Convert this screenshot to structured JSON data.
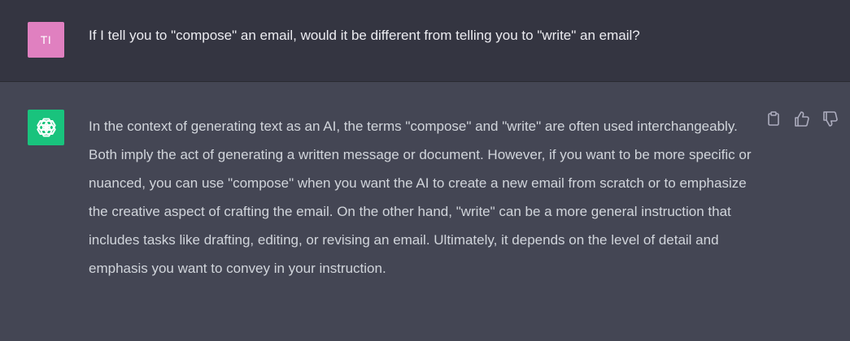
{
  "user": {
    "avatar_initials": "TI",
    "avatar_color": "#e080c0",
    "message": "If I tell you to \"compose\" an email, would it be different from telling you to \"write\" an email?"
  },
  "assistant": {
    "avatar_icon": "openai-logo-icon",
    "avatar_color": "#19c37d",
    "message": "In the context of generating text as an AI, the terms \"compose\" and \"write\" are often used interchangeably. Both imply the act of generating a written message or document. However, if you want to be more specific or nuanced, you can use \"compose\" when you want the AI to create a new email from scratch or to emphasize the creative aspect of crafting the email. On the other hand, \"write\" can be a more general instruction that includes tasks like drafting, editing, or revising an email. Ultimately, it depends on the level of detail and emphasis you want to convey in your instruction.",
    "actions": [
      "clipboard-icon",
      "thumbs-up-icon",
      "thumbs-down-icon"
    ]
  },
  "colors": {
    "user_row_bg": "#343541",
    "assistant_row_bg": "#444654",
    "text": "#d1d5db"
  }
}
